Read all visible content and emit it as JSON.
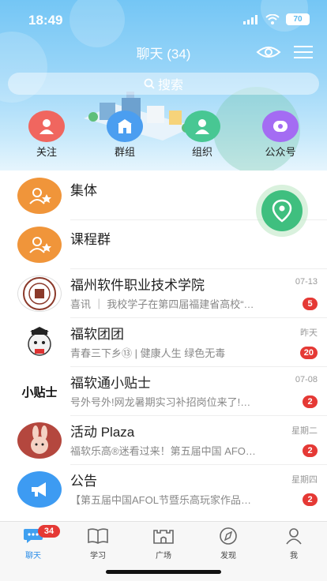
{
  "status_bar": {
    "time": "18:49",
    "battery": "70"
  },
  "nav": {
    "title": "聊天 (34)"
  },
  "search": {
    "label": "搜索"
  },
  "shortcuts": [
    {
      "label": "关注",
      "color": "#f0665f"
    },
    {
      "label": "群组",
      "color": "#4b9ef0"
    },
    {
      "label": "组织",
      "color": "#48c793"
    },
    {
      "label": "公众号",
      "color": "#a46cf3"
    }
  ],
  "chats": [
    {
      "name": "集体",
      "preview": "",
      "time": "",
      "badge": ""
    },
    {
      "name": "课程群",
      "preview": "",
      "time": "",
      "badge": ""
    },
    {
      "name": "福州软件职业技术学院",
      "preview": "喜讯 ｜ 我校学子在第四届福建省高校“…",
      "time": "07-13",
      "badge": "5"
    },
    {
      "name": "福软团团",
      "preview": "青春三下乡⑬ | 健康人生 绿色无毒",
      "time": "昨天",
      "badge": "20"
    },
    {
      "name": "福软通小贴士",
      "preview": "号外号外!网龙暑期实习补招岗位来了!…",
      "time": "07-08",
      "badge": "2"
    },
    {
      "name": "活动 Plaza",
      "preview": "福软乐高®迷看过来！第五届中国 AFO…",
      "time": "星期二",
      "badge": "2"
    },
    {
      "name": "公告",
      "preview": "【第五届中国AFOL节暨乐高玩家作品…",
      "time": "星期四",
      "badge": "2"
    }
  ],
  "avatar_texts": {
    "tips": "小贴士"
  },
  "tabs": [
    {
      "label": "聊天",
      "badge": "34"
    },
    {
      "label": "学习"
    },
    {
      "label": "广场"
    },
    {
      "label": "发现"
    },
    {
      "label": "我"
    }
  ],
  "colors": {
    "accent": "#2c8ee8",
    "badge": "#e53935",
    "group_avatar": "#f0953a"
  }
}
